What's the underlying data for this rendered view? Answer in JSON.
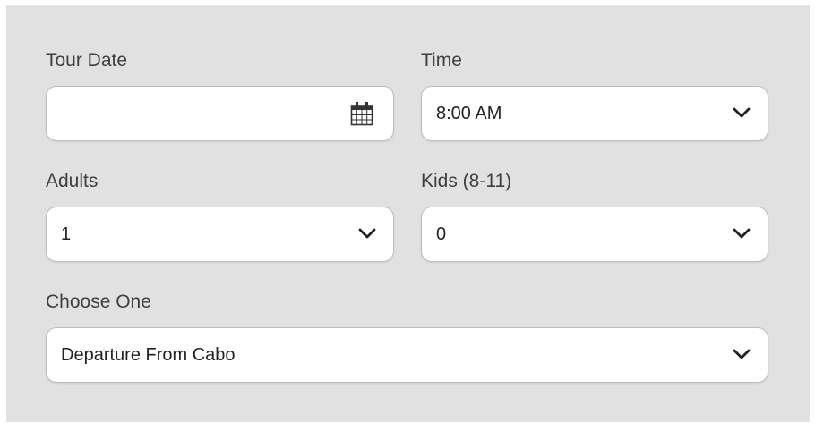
{
  "form": {
    "tour_date": {
      "label": "Tour Date",
      "value": "",
      "icon": "calendar-icon"
    },
    "time": {
      "label": "Time",
      "selected": "8:00 AM",
      "icon": "chevron-down-icon"
    },
    "adults": {
      "label": "Adults",
      "selected": "1",
      "icon": "chevron-down-icon"
    },
    "kids": {
      "label": "Kids (8-11)",
      "selected": "0",
      "icon": "chevron-down-icon"
    },
    "choose_one": {
      "label": "Choose One",
      "selected": "Departure From Cabo",
      "icon": "chevron-down-icon"
    }
  },
  "colors": {
    "panel_background": "#e1e1e1",
    "field_background": "#ffffff",
    "field_border": "#bdbdbd",
    "label_text": "#3f3f3f"
  }
}
